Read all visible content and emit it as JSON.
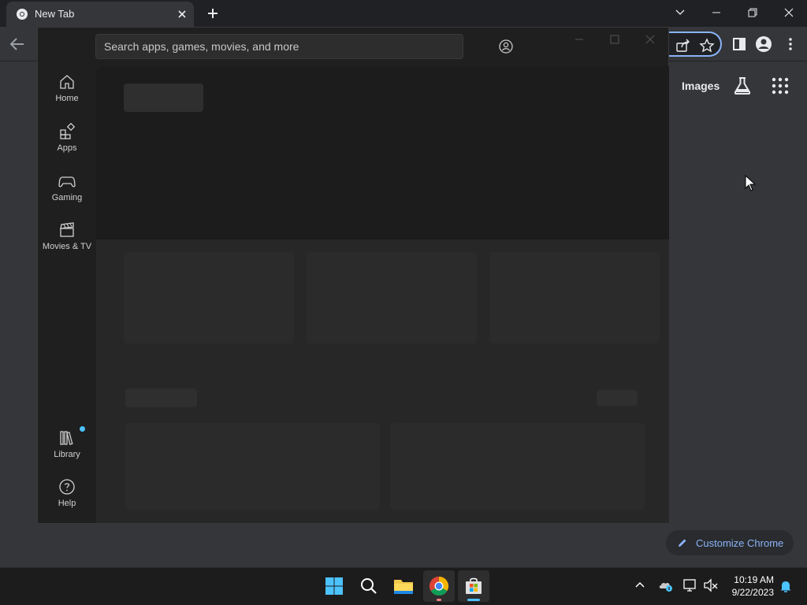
{
  "browser": {
    "tab_title": "New Tab",
    "new_tab_label": "+",
    "ntp": {
      "images_link": "Images",
      "customize_label": "Customize Chrome"
    }
  },
  "store": {
    "search_placeholder": "Search apps, games, movies, and more",
    "nav": [
      {
        "label": "Home",
        "icon": "home-icon"
      },
      {
        "label": "Apps",
        "icon": "apps-icon"
      },
      {
        "label": "Gaming",
        "icon": "gamepad-icon"
      },
      {
        "label": "Movies & TV",
        "icon": "clapperboard-icon"
      }
    ],
    "nav_bottom": [
      {
        "label": "Library",
        "icon": "library-icon"
      },
      {
        "label": "Help",
        "icon": "help-icon"
      }
    ]
  },
  "taskbar": {
    "time": "10:19 AM",
    "date": "9/22/2023"
  },
  "colors": {
    "accent": "#8ab4f8",
    "windows_blue": "#0078d4"
  }
}
